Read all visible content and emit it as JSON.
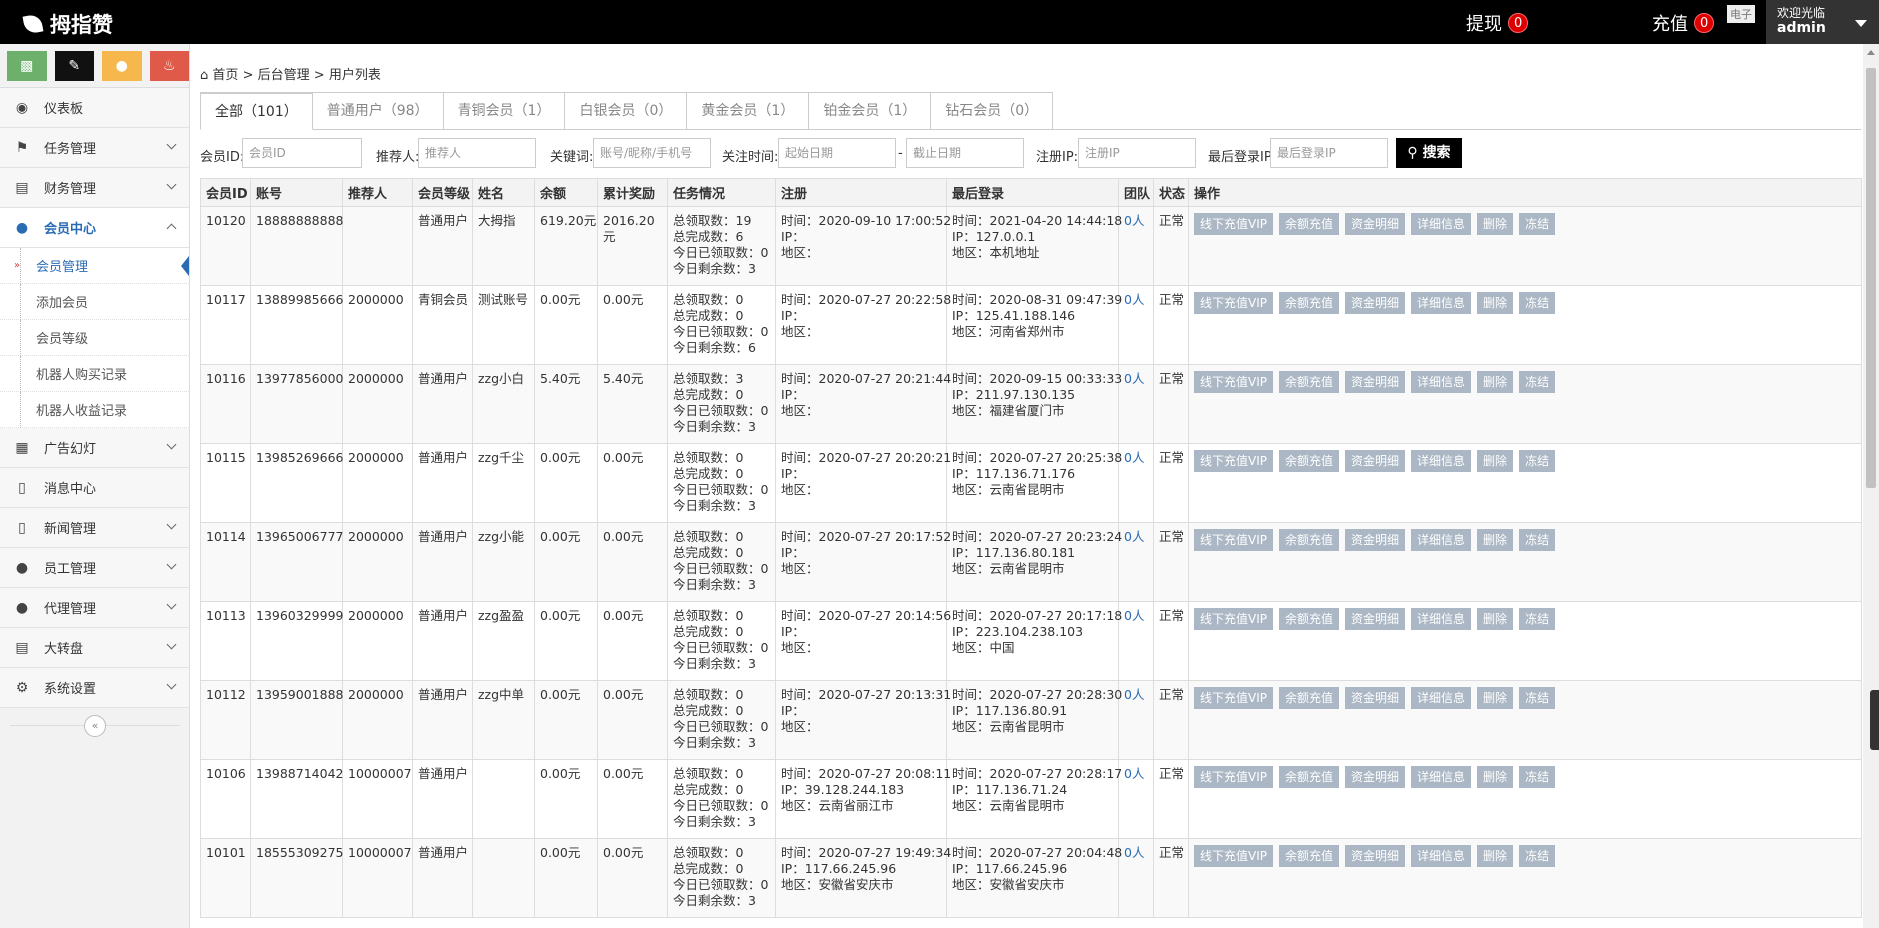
{
  "header": {
    "logo": "拇指赞",
    "withdraw_label": "提现",
    "withdraw_count": "0",
    "recharge_label": "充值",
    "recharge_count": "0",
    "tip": "电子",
    "welcome": "欢迎光临",
    "username": "admin"
  },
  "sidebar": {
    "shortcuts": [
      "signal-icon",
      "pencil-icon",
      "users-icon",
      "bell-icon"
    ],
    "items": [
      {
        "label": "仪表板",
        "icon": "dashboard-icon"
      },
      {
        "label": "任务管理",
        "icon": "flag-icon"
      },
      {
        "label": "财务管理",
        "icon": "drive-icon"
      },
      {
        "label": "会员中心",
        "icon": "user-icon"
      },
      {
        "label": "广告幻灯",
        "icon": "picture-icon"
      },
      {
        "label": "消息中心",
        "icon": "bookmark-icon"
      },
      {
        "label": "新闻管理",
        "icon": "bookmark-icon"
      },
      {
        "label": "员工管理",
        "icon": "user-icon"
      },
      {
        "label": "代理管理",
        "icon": "user-icon"
      },
      {
        "label": "大转盘",
        "icon": "drive-icon"
      },
      {
        "label": "系统设置",
        "icon": "gear-icon"
      }
    ],
    "submenu": [
      "会员管理",
      "添加会员",
      "会员等级",
      "机器人购买记录",
      "机器人收益记录"
    ]
  },
  "breadcrumb": {
    "home": "首页",
    "sep": ">",
    "level2": "后台管理",
    "level3": "用户列表"
  },
  "tabs": [
    {
      "label": "全部（101）"
    },
    {
      "label": "普通用户（98）"
    },
    {
      "label": "青铜会员（1）"
    },
    {
      "label": "白银会员（0）"
    },
    {
      "label": "黄金会员（1）"
    },
    {
      "label": "铂金会员（1）"
    },
    {
      "label": "钻石会员（0）"
    }
  ],
  "filters": {
    "member_id_label": "会员ID:",
    "member_id_placeholder": "会员ID",
    "referrer_label": "推荐人:",
    "referrer_placeholder": "推荐人",
    "keyword_label": "关键词:",
    "keyword_placeholder": "账号/昵称/手机号",
    "follow_time_label": "关注时间:",
    "start_date_placeholder": "起始日期",
    "dash": "-",
    "end_date_placeholder": "截止日期",
    "reg_ip_label": "注册IP:",
    "reg_ip_placeholder": "注册IP",
    "last_ip_label": "最后登录IP:",
    "last_ip_placeholder": "最后登录IP",
    "search_label": "搜索"
  },
  "table": {
    "headers": [
      "会员ID",
      "账号",
      "推荐人",
      "会员等级",
      "姓名",
      "余额",
      "累计奖励",
      "任务情况",
      "注册",
      "最后登录",
      "团队",
      "状态",
      "操作"
    ],
    "op_buttons": [
      "线下充值VIP",
      "余额充值",
      "资金明细",
      "详细信息",
      "删除",
      "冻结"
    ],
    "rows": [
      {
        "id": "10120",
        "account": "18888888888",
        "referrer": "",
        "level": "普通用户",
        "name": "大拇指",
        "balance": "619.20元",
        "reward": "2016.20元",
        "task": [
          "总领取数：19",
          "总完成数：6",
          "今日已领取数：0",
          "今日剩余数：3"
        ],
        "reg": [
          "时间：2020-09-10 17:00:52",
          "IP：",
          "地区："
        ],
        "last": [
          "时间：2021-04-20 14:44:18",
          "IP：127.0.0.1",
          "地区：本机地址"
        ],
        "team": "0人",
        "status": "正常"
      },
      {
        "id": "10117",
        "account": "13889985666",
        "referrer": "2000000",
        "level": "青铜会员",
        "name": "测试账号",
        "balance": "0.00元",
        "reward": "0.00元",
        "task": [
          "总领取数：0",
          "总完成数：0",
          "今日已领取数：0",
          "今日剩余数：6"
        ],
        "reg": [
          "时间：2020-07-27 20:22:58",
          "IP：",
          "地区："
        ],
        "last": [
          "时间：2020-08-31 09:47:39",
          "IP：125.41.188.146",
          "地区：河南省郑州市"
        ],
        "team": "0人",
        "status": "正常"
      },
      {
        "id": "10116",
        "account": "13977856000",
        "referrer": "2000000",
        "level": "普通用户",
        "name": "zzg小白",
        "balance": "5.40元",
        "reward": "5.40元",
        "task": [
          "总领取数：3",
          "总完成数：0",
          "今日已领取数：0",
          "今日剩余数：3"
        ],
        "reg": [
          "时间：2020-07-27 20:21:44",
          "IP：",
          "地区："
        ],
        "last": [
          "时间：2020-09-15 00:33:33",
          "IP：211.97.130.135",
          "地区：福建省厦门市"
        ],
        "team": "0人",
        "status": "正常"
      },
      {
        "id": "10115",
        "account": "13985269666",
        "referrer": "2000000",
        "level": "普通用户",
        "name": "zzg千尘",
        "balance": "0.00元",
        "reward": "0.00元",
        "task": [
          "总领取数：0",
          "总完成数：0",
          "今日已领取数：0",
          "今日剩余数：3"
        ],
        "reg": [
          "时间：2020-07-27 20:20:21",
          "IP：",
          "地区："
        ],
        "last": [
          "时间：2020-07-27 20:25:38",
          "IP：117.136.71.176",
          "地区：云南省昆明市"
        ],
        "team": "0人",
        "status": "正常"
      },
      {
        "id": "10114",
        "account": "13965006777",
        "referrer": "2000000",
        "level": "普通用户",
        "name": "zzg小能",
        "balance": "0.00元",
        "reward": "0.00元",
        "task": [
          "总领取数：0",
          "总完成数：0",
          "今日已领取数：0",
          "今日剩余数：3"
        ],
        "reg": [
          "时间：2020-07-27 20:17:52",
          "IP：",
          "地区："
        ],
        "last": [
          "时间：2020-07-27 20:23:24",
          "IP：117.136.80.181",
          "地区：云南省昆明市"
        ],
        "team": "0人",
        "status": "正常"
      },
      {
        "id": "10113",
        "account": "13960329999",
        "referrer": "2000000",
        "level": "普通用户",
        "name": "zzg盈盈",
        "balance": "0.00元",
        "reward": "0.00元",
        "task": [
          "总领取数：0",
          "总完成数：0",
          "今日已领取数：0",
          "今日剩余数：3"
        ],
        "reg": [
          "时间：2020-07-27 20:14:56",
          "IP：",
          "地区："
        ],
        "last": [
          "时间：2020-07-27 20:17:18",
          "IP：223.104.238.103",
          "地区：中国"
        ],
        "team": "0人",
        "status": "正常"
      },
      {
        "id": "10112",
        "account": "13959001888",
        "referrer": "2000000",
        "level": "普通用户",
        "name": "zzg中单",
        "balance": "0.00元",
        "reward": "0.00元",
        "task": [
          "总领取数：0",
          "总完成数：0",
          "今日已领取数：0",
          "今日剩余数：3"
        ],
        "reg": [
          "时间：2020-07-27 20:13:31",
          "IP：",
          "地区："
        ],
        "last": [
          "时间：2020-07-27 20:28:30",
          "IP：117.136.80.91",
          "地区：云南省昆明市"
        ],
        "team": "0人",
        "status": "正常"
      },
      {
        "id": "10106",
        "account": "13988714042",
        "referrer": "10000007",
        "level": "普通用户",
        "name": "",
        "balance": "0.00元",
        "reward": "0.00元",
        "task": [
          "总领取数：0",
          "总完成数：0",
          "今日已领取数：0",
          "今日剩余数：3"
        ],
        "reg": [
          "时间：2020-07-27 20:08:11",
          "IP：39.128.244.183",
          "地区：云南省丽江市"
        ],
        "last": [
          "时间：2020-07-27 20:28:17",
          "IP：117.136.71.24",
          "地区：云南省昆明市"
        ],
        "team": "0人",
        "status": "正常"
      },
      {
        "id": "10101",
        "account": "18555309275",
        "referrer": "10000007",
        "level": "普通用户",
        "name": "",
        "balance": "0.00元",
        "reward": "0.00元",
        "task": [
          "总领取数：0",
          "总完成数：0",
          "今日已领取数：0",
          "今日剩余数：3"
        ],
        "reg": [
          "时间：2020-07-27 19:49:34",
          "IP：117.66.245.96",
          "地区：安徽省安庆市"
        ],
        "last": [
          "时间：2020-07-27 20:04:48",
          "IP：117.66.245.96",
          "地区：安徽省安庆市"
        ],
        "team": "0人",
        "status": "正常"
      }
    ]
  }
}
